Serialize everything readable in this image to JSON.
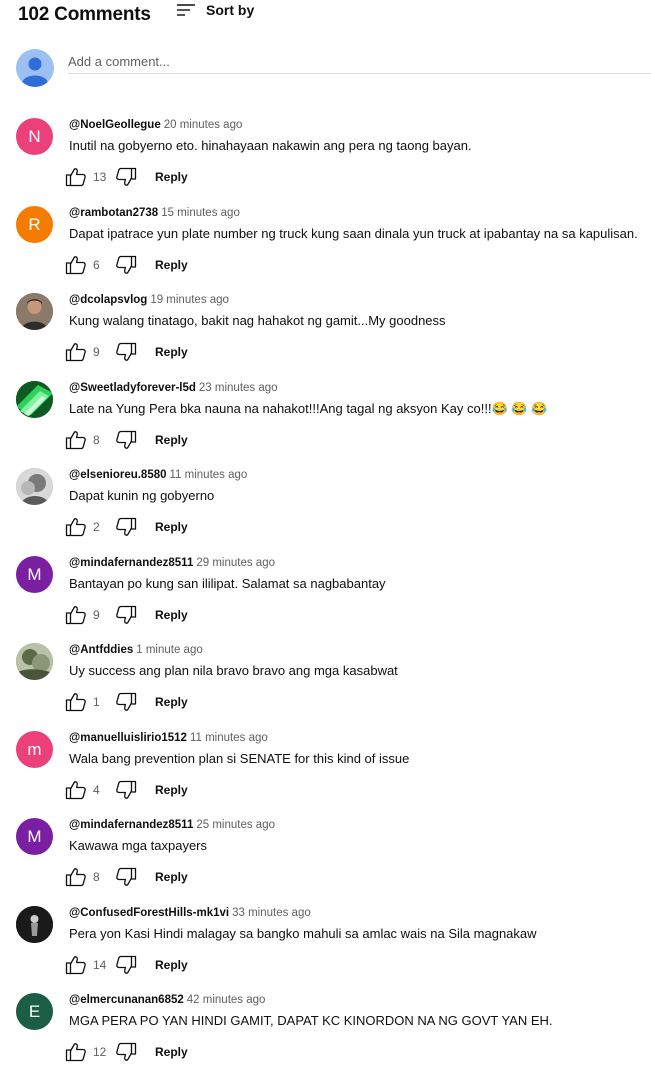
{
  "header": {
    "comment_count": "102 Comments",
    "sort_label": "Sort by",
    "sort_icon": "sort-lines-icon"
  },
  "add_comment": {
    "placeholder": "Add a comment...",
    "avatar_icon": "user-avatar-icon"
  },
  "actions": {
    "like_icon": "thumbs-up-icon",
    "dislike_icon": "thumbs-down-icon",
    "reply_label": "Reply"
  },
  "colors": {
    "text": "#0f0f0f",
    "secondary": "#606060",
    "divider": "#d8d8d8"
  },
  "comments": [
    {
      "author": "@NoelGeollegue",
      "time": "20 minutes ago",
      "text": "Inutil na gobyerno eto. hinahayaan nakawin ang pera ng taong bayan.",
      "likes": "13",
      "avatar_letter": "N",
      "avatar_color": "#ec407a"
    },
    {
      "author": "@rambotan2738",
      "time": "15 minutes ago",
      "text": "Dapat ipatrace yun plate number ng truck kung saan dinala yun truck at ipabantay na sa kapulisan.",
      "likes": "6",
      "avatar_letter": "R",
      "avatar_color": "#f57c00"
    },
    {
      "author": "@dcolapsvlog",
      "time": "19 minutes ago",
      "text": "Kung walang tinatago, bakit nag hahakot ng gamit...My goodness",
      "likes": "9",
      "avatar_letter": "",
      "avatar_color": "#5a4a3c"
    },
    {
      "author": "@Sweetladyforever-l5d",
      "time": "23 minutes ago",
      "text": "Late na Yung Pera bka nauna na nahakot!!!Ang tagal ng aksyon Kay co!!!😂 😂 😂",
      "likes": "8",
      "avatar_letter": "",
      "avatar_color": "#1e9e3a"
    },
    {
      "author": "@elsenioreu.8580",
      "time": "11 minutes ago",
      "text": "Dapat  kunin ng gobyerno",
      "likes": "2",
      "avatar_letter": "",
      "avatar_color": "#9a9a9a"
    },
    {
      "author": "@mindafernandez8511",
      "time": "29 minutes ago",
      "text": "Bantayan po kung san ililipat. Salamat sa  nagbabantay",
      "likes": "9",
      "avatar_letter": "M",
      "avatar_color": "#7b1fa2"
    },
    {
      "author": "@Antfddies",
      "time": "1 minute ago",
      "text": "Uy success ang plan nila bravo bravo ang mga kasabwat",
      "likes": "1",
      "avatar_letter": "",
      "avatar_color": "#7c8a6a"
    },
    {
      "author": "@manuelluislirio1512",
      "time": "11 minutes ago",
      "text": "Wala bang prevention plan si SENATE for this kind of issue",
      "likes": "4",
      "avatar_letter": "m",
      "avatar_color": "#ec407a"
    },
    {
      "author": "@mindafernandez8511",
      "time": "25 minutes ago",
      "text": "Kawawa mga taxpayers",
      "likes": "8",
      "avatar_letter": "M",
      "avatar_color": "#7b1fa2"
    },
    {
      "author": "@ConfusedForestHills-mk1vi",
      "time": "33 minutes ago",
      "text": "Pera yon Kasi Hindi malagay sa bangko mahuli sa amlac wais na Sila magnakaw",
      "likes": "14",
      "avatar_letter": "",
      "avatar_color": "#1d1d1d"
    },
    {
      "author": "@elmercunanan6852",
      "time": "42 minutes ago",
      "text": "MGA PERA PO YAN HINDI GAMIT, DAPAT KC KINORDON NA NG GOVT YAN EH.",
      "likes": "12",
      "avatar_letter": "E",
      "avatar_color": "#1b5e45"
    }
  ]
}
